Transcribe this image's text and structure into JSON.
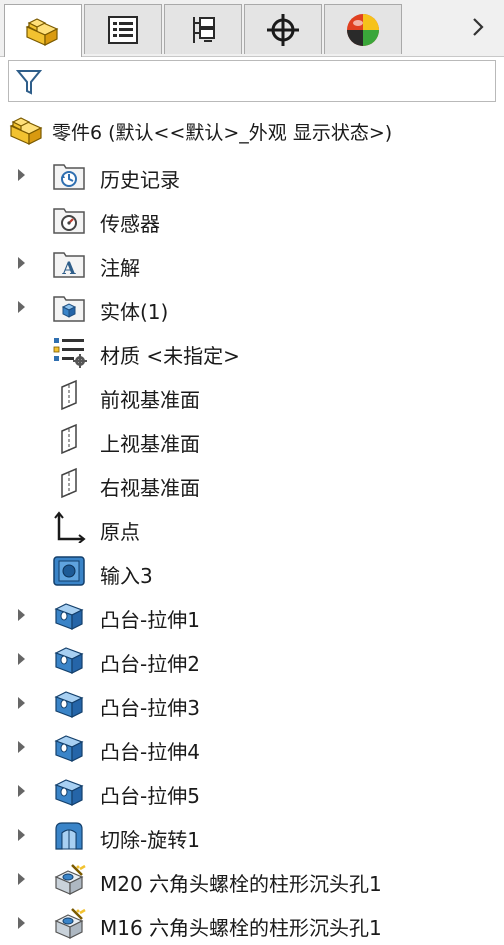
{
  "tabs": [
    {
      "icon": "part-icon",
      "active": true
    },
    {
      "icon": "property-manager-icon",
      "active": false
    },
    {
      "icon": "configuration-manager-icon",
      "active": false
    },
    {
      "icon": "dimxpert-icon",
      "active": false
    },
    {
      "icon": "display-manager-icon",
      "active": false
    }
  ],
  "tab_more": "›",
  "filter": {
    "placeholder": "",
    "value": ""
  },
  "root": {
    "label": "零件6  (默认<<默认>_外观 显示状态>)"
  },
  "items": [
    {
      "label": "历史记录",
      "icon": "history-folder-icon",
      "expandable": true
    },
    {
      "label": "传感器",
      "icon": "sensor-folder-icon",
      "expandable": false
    },
    {
      "label": "注解",
      "icon": "annotations-folder-icon",
      "expandable": true
    },
    {
      "label": "实体(1)",
      "icon": "solid-bodies-folder-icon",
      "expandable": true
    },
    {
      "label": "材质 <未指定>",
      "icon": "material-icon",
      "expandable": false
    },
    {
      "label": "前视基准面",
      "icon": "plane-icon",
      "expandable": false
    },
    {
      "label": "上视基准面",
      "icon": "plane-icon",
      "expandable": false
    },
    {
      "label": "右视基准面",
      "icon": "plane-icon",
      "expandable": false
    },
    {
      "label": "原点",
      "icon": "origin-icon",
      "expandable": false
    },
    {
      "label": "输入3",
      "icon": "imported-body-icon",
      "expandable": false
    },
    {
      "label": "凸台-拉伸1",
      "icon": "boss-extrude-icon",
      "expandable": true
    },
    {
      "label": "凸台-拉伸2",
      "icon": "boss-extrude-icon",
      "expandable": true
    },
    {
      "label": "凸台-拉伸3",
      "icon": "boss-extrude-icon",
      "expandable": true
    },
    {
      "label": "凸台-拉伸4",
      "icon": "boss-extrude-icon",
      "expandable": true
    },
    {
      "label": "凸台-拉伸5",
      "icon": "boss-extrude-icon",
      "expandable": true
    },
    {
      "label": "切除-旋转1",
      "icon": "cut-revolve-icon",
      "expandable": true
    },
    {
      "label": "M20 六角头螺栓的柱形沉头孔1",
      "icon": "hole-wizard-icon",
      "expandable": true
    },
    {
      "label": "M16 六角头螺栓的柱形沉头孔1",
      "icon": "hole-wizard-icon",
      "expandable": true
    }
  ],
  "colors": {
    "tab_active": "#ffffff",
    "tab_inactive": "#e4e4e4",
    "part_yellow": "#f2c230",
    "body_blue": "#3a84c8"
  }
}
